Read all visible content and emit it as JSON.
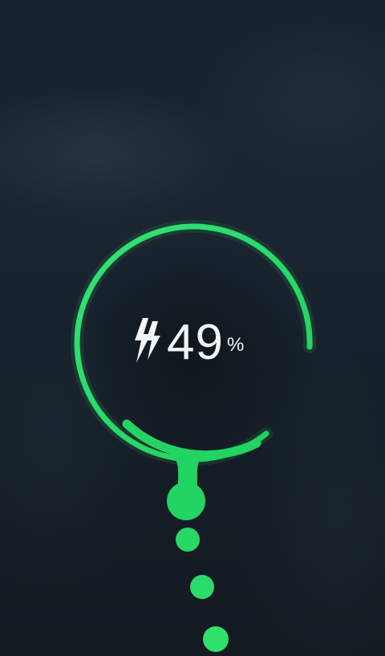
{
  "battery": {
    "level_value": "49",
    "level_unit": "%",
    "level_percent": 49,
    "charging": true,
    "icon": "charging-bolt-icon"
  },
  "colors": {
    "accent": "#2ee06c",
    "accent_dark": "#16b34c",
    "text": "#f2f5f7",
    "background": "#16202a"
  }
}
